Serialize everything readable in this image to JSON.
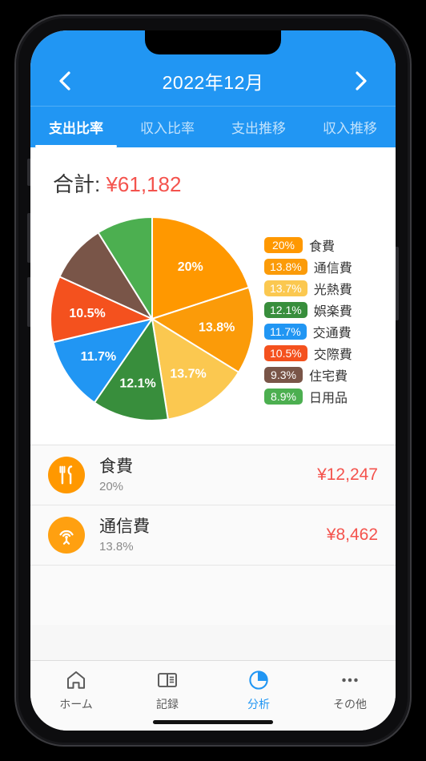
{
  "header": {
    "prev_icon": "chevron-left-icon",
    "next_icon": "chevron-right-icon",
    "month_title": "2022年12月",
    "tabs": [
      {
        "label": "支出比率",
        "active": true
      },
      {
        "label": "収入比率",
        "active": false
      },
      {
        "label": "支出推移",
        "active": false
      },
      {
        "label": "収入推移",
        "active": false
      }
    ]
  },
  "summary": {
    "total_label": "合計:",
    "total_amount": "¥61,182"
  },
  "chart_data": {
    "type": "pie",
    "title": "支出比率",
    "legend_position": "right",
    "start_angle": 0,
    "direction": "clockwise",
    "categories": [
      "食費",
      "通信費",
      "光熱費",
      "娯楽費",
      "交通費",
      "交際費",
      "住宅費",
      "日用品"
    ],
    "values": [
      20,
      13.8,
      13.7,
      12.1,
      11.7,
      10.5,
      9.3,
      8.9
    ],
    "labels": [
      "20%",
      "13.8%",
      "13.7%",
      "12.1%",
      "11.7%",
      "10.5%",
      "9.3%",
      "8.9%"
    ],
    "slice_labels_shown": [
      "20%",
      "13.8%",
      "13.7%",
      "12.1%",
      "11.7%",
      "10.5%"
    ],
    "colors": [
      "#FF9800",
      "#FB9B09",
      "#FBC850",
      "#388E3C",
      "#2196F3",
      "#F4511E",
      "#795548",
      "#4CAF50"
    ]
  },
  "category_list": [
    {
      "icon": "restaurant-icon",
      "icon_color": "#FF9800",
      "name": "食費",
      "percent": "20%",
      "amount": "¥12,247"
    },
    {
      "icon": "broadcast-tower-icon",
      "icon_color": "#FFA010",
      "name": "通信費",
      "percent": "13.8%",
      "amount": "¥8,462"
    }
  ],
  "bottom_nav": [
    {
      "icon": "home-icon",
      "label": "ホーム",
      "active": false
    },
    {
      "icon": "book-icon",
      "label": "記録",
      "active": false
    },
    {
      "icon": "pie-chart-icon",
      "label": "分析",
      "active": true
    },
    {
      "icon": "ellipsis-icon",
      "label": "その他",
      "active": false
    }
  ],
  "theme": {
    "accent": "#2196F3",
    "amount_red": "#F4534D"
  }
}
